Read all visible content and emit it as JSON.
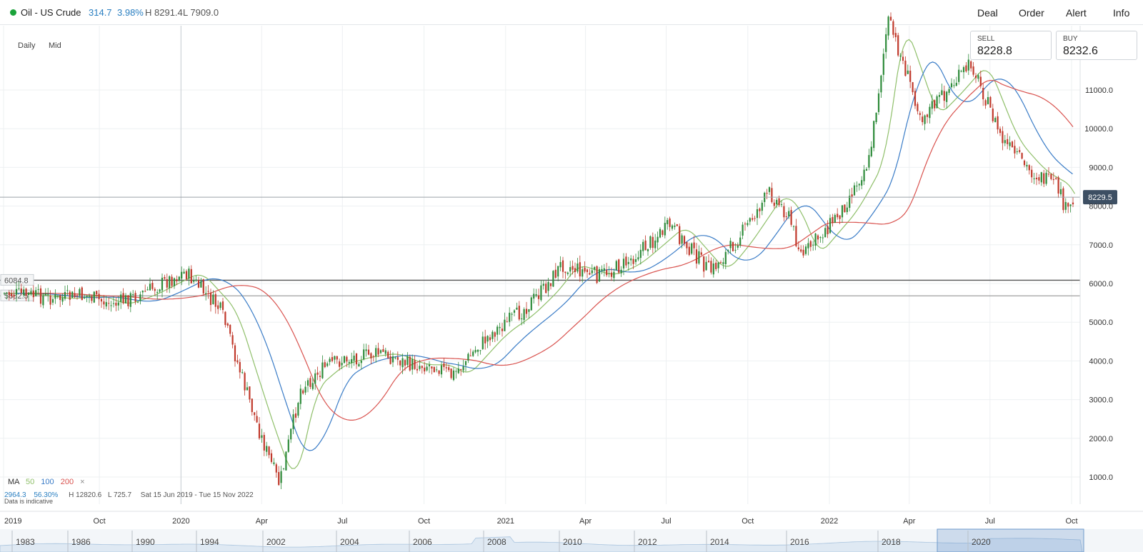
{
  "header": {
    "instrument": "Oil - US Crude",
    "change_points": "314.7",
    "change_percent": "3.98%",
    "high": "H 8291.4",
    "low": "L 7909.0",
    "status_color": "#1aa33a",
    "nav": [
      "Deal",
      "Order",
      "Alert",
      "Info"
    ]
  },
  "controls": {
    "timeframe": "Daily",
    "price_type": "Mid"
  },
  "quotes": {
    "sell_label": "SELL",
    "sell_value": "8228.8",
    "buy_label": "BUY",
    "buy_value": "8232.6"
  },
  "ma_legend": {
    "label": "MA",
    "periods": [
      "50",
      "100",
      "200"
    ],
    "colors": [
      "#8fbf6a",
      "#3a7cc7",
      "#d9534f"
    ],
    "close": "×"
  },
  "stats": {
    "range_value": "2964.3",
    "range_percent": "56.30%",
    "high": "H 12820.6",
    "low": "L 725.7",
    "dates": "Sat 15 Jun 2019 - Tue 15 Nov 2022"
  },
  "footnote": "Data is indicative",
  "price_marker": "8229.5",
  "level_labels": [
    "6084.8",
    "5682.5"
  ],
  "timeline_labels": [
    "1983",
    "1986",
    "1990",
    "1994",
    "2002",
    "2004",
    "2006",
    "2008",
    "2010",
    "2012",
    "2014",
    "2016",
    "2018",
    "2020"
  ],
  "chart_data": {
    "type": "line",
    "title": "Oil - US Crude",
    "x": [
      "2019-06-15",
      "2019-07-15",
      "2019-08-15",
      "2019-09-15",
      "2019-10-15",
      "2019-11-15",
      "2019-12-15",
      "2020-01-06",
      "2020-02-15",
      "2020-03-15",
      "2020-04-01",
      "2020-04-21",
      "2020-05-15",
      "2020-06-15",
      "2020-07-15",
      "2020-08-15",
      "2020-09-15",
      "2020-10-15",
      "2020-11-01",
      "2020-12-15",
      "2021-01-15",
      "2021-02-15",
      "2021-03-05",
      "2021-04-15",
      "2021-05-15",
      "2021-06-15",
      "2021-07-05",
      "2021-08-20",
      "2021-09-15",
      "2021-10-25",
      "2021-11-15",
      "2021-12-01",
      "2022-01-15",
      "2022-02-15",
      "2022-03-08",
      "2022-04-15",
      "2022-05-15",
      "2022-06-10",
      "2022-07-15",
      "2022-08-15",
      "2022-09-15",
      "2022-09-26",
      "2022-10-05"
    ],
    "series": [
      {
        "name": "Price",
        "values": [
          5750,
          5700,
          5600,
          5700,
          5450,
          5700,
          6050,
          6300,
          5300,
          3200,
          2000,
          800,
          3300,
          3900,
          4100,
          4200,
          3900,
          3900,
          3600,
          4700,
          5200,
          5900,
          6500,
          6200,
          6500,
          7100,
          7500,
          6300,
          7000,
          8350,
          7800,
          6700,
          7900,
          9200,
          12820,
          10300,
          11000,
          11700,
          9700,
          8900,
          8500,
          7800,
          8229.5
        ]
      }
    ],
    "x_ticks": [
      "2019",
      "Oct",
      "2020",
      "Apr",
      "Jul",
      "Oct",
      "2021",
      "Apr",
      "Jul",
      "Oct",
      "2022",
      "Apr",
      "Jul",
      "Oct"
    ],
    "y_ticks": [
      "1000.0",
      "2000.0",
      "3000.0",
      "4000.0",
      "5000.0",
      "6000.0",
      "7000.0",
      "8000.0",
      "9000.0",
      "10000.0",
      "11000.0"
    ],
    "ylim": [
      725.7,
      12820.6
    ],
    "horizontal_levels": [
      6084.8,
      5682.5
    ],
    "current_price": 8229.5,
    "moving_averages": [
      {
        "period": "50",
        "color": "#8fbf6a"
      },
      {
        "period": "100",
        "color": "#3a7cc7"
      },
      {
        "period": "200",
        "color": "#d9534f"
      }
    ],
    "grid": true
  }
}
